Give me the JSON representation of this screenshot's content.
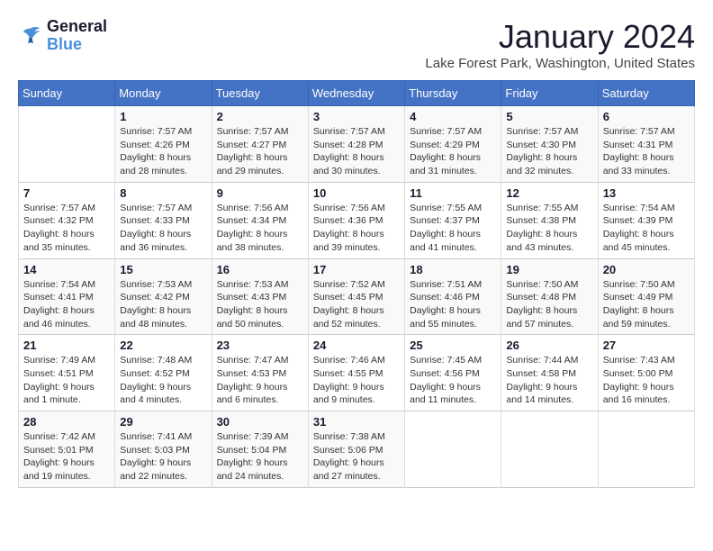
{
  "header": {
    "logo_text_general": "General",
    "logo_text_blue": "Blue",
    "month_title": "January 2024",
    "location": "Lake Forest Park, Washington, United States"
  },
  "weekdays": [
    "Sunday",
    "Monday",
    "Tuesday",
    "Wednesday",
    "Thursday",
    "Friday",
    "Saturday"
  ],
  "weeks": [
    [
      {
        "day": "",
        "sunrise": "",
        "sunset": "",
        "daylight": ""
      },
      {
        "day": "1",
        "sunrise": "Sunrise: 7:57 AM",
        "sunset": "Sunset: 4:26 PM",
        "daylight": "Daylight: 8 hours and 28 minutes."
      },
      {
        "day": "2",
        "sunrise": "Sunrise: 7:57 AM",
        "sunset": "Sunset: 4:27 PM",
        "daylight": "Daylight: 8 hours and 29 minutes."
      },
      {
        "day": "3",
        "sunrise": "Sunrise: 7:57 AM",
        "sunset": "Sunset: 4:28 PM",
        "daylight": "Daylight: 8 hours and 30 minutes."
      },
      {
        "day": "4",
        "sunrise": "Sunrise: 7:57 AM",
        "sunset": "Sunset: 4:29 PM",
        "daylight": "Daylight: 8 hours and 31 minutes."
      },
      {
        "day": "5",
        "sunrise": "Sunrise: 7:57 AM",
        "sunset": "Sunset: 4:30 PM",
        "daylight": "Daylight: 8 hours and 32 minutes."
      },
      {
        "day": "6",
        "sunrise": "Sunrise: 7:57 AM",
        "sunset": "Sunset: 4:31 PM",
        "daylight": "Daylight: 8 hours and 33 minutes."
      }
    ],
    [
      {
        "day": "7",
        "sunrise": "Sunrise: 7:57 AM",
        "sunset": "Sunset: 4:32 PM",
        "daylight": "Daylight: 8 hours and 35 minutes."
      },
      {
        "day": "8",
        "sunrise": "Sunrise: 7:57 AM",
        "sunset": "Sunset: 4:33 PM",
        "daylight": "Daylight: 8 hours and 36 minutes."
      },
      {
        "day": "9",
        "sunrise": "Sunrise: 7:56 AM",
        "sunset": "Sunset: 4:34 PM",
        "daylight": "Daylight: 8 hours and 38 minutes."
      },
      {
        "day": "10",
        "sunrise": "Sunrise: 7:56 AM",
        "sunset": "Sunset: 4:36 PM",
        "daylight": "Daylight: 8 hours and 39 minutes."
      },
      {
        "day": "11",
        "sunrise": "Sunrise: 7:55 AM",
        "sunset": "Sunset: 4:37 PM",
        "daylight": "Daylight: 8 hours and 41 minutes."
      },
      {
        "day": "12",
        "sunrise": "Sunrise: 7:55 AM",
        "sunset": "Sunset: 4:38 PM",
        "daylight": "Daylight: 8 hours and 43 minutes."
      },
      {
        "day": "13",
        "sunrise": "Sunrise: 7:54 AM",
        "sunset": "Sunset: 4:39 PM",
        "daylight": "Daylight: 8 hours and 45 minutes."
      }
    ],
    [
      {
        "day": "14",
        "sunrise": "Sunrise: 7:54 AM",
        "sunset": "Sunset: 4:41 PM",
        "daylight": "Daylight: 8 hours and 46 minutes."
      },
      {
        "day": "15",
        "sunrise": "Sunrise: 7:53 AM",
        "sunset": "Sunset: 4:42 PM",
        "daylight": "Daylight: 8 hours and 48 minutes."
      },
      {
        "day": "16",
        "sunrise": "Sunrise: 7:53 AM",
        "sunset": "Sunset: 4:43 PM",
        "daylight": "Daylight: 8 hours and 50 minutes."
      },
      {
        "day": "17",
        "sunrise": "Sunrise: 7:52 AM",
        "sunset": "Sunset: 4:45 PM",
        "daylight": "Daylight: 8 hours and 52 minutes."
      },
      {
        "day": "18",
        "sunrise": "Sunrise: 7:51 AM",
        "sunset": "Sunset: 4:46 PM",
        "daylight": "Daylight: 8 hours and 55 minutes."
      },
      {
        "day": "19",
        "sunrise": "Sunrise: 7:50 AM",
        "sunset": "Sunset: 4:48 PM",
        "daylight": "Daylight: 8 hours and 57 minutes."
      },
      {
        "day": "20",
        "sunrise": "Sunrise: 7:50 AM",
        "sunset": "Sunset: 4:49 PM",
        "daylight": "Daylight: 8 hours and 59 minutes."
      }
    ],
    [
      {
        "day": "21",
        "sunrise": "Sunrise: 7:49 AM",
        "sunset": "Sunset: 4:51 PM",
        "daylight": "Daylight: 9 hours and 1 minute."
      },
      {
        "day": "22",
        "sunrise": "Sunrise: 7:48 AM",
        "sunset": "Sunset: 4:52 PM",
        "daylight": "Daylight: 9 hours and 4 minutes."
      },
      {
        "day": "23",
        "sunrise": "Sunrise: 7:47 AM",
        "sunset": "Sunset: 4:53 PM",
        "daylight": "Daylight: 9 hours and 6 minutes."
      },
      {
        "day": "24",
        "sunrise": "Sunrise: 7:46 AM",
        "sunset": "Sunset: 4:55 PM",
        "daylight": "Daylight: 9 hours and 9 minutes."
      },
      {
        "day": "25",
        "sunrise": "Sunrise: 7:45 AM",
        "sunset": "Sunset: 4:56 PM",
        "daylight": "Daylight: 9 hours and 11 minutes."
      },
      {
        "day": "26",
        "sunrise": "Sunrise: 7:44 AM",
        "sunset": "Sunset: 4:58 PM",
        "daylight": "Daylight: 9 hours and 14 minutes."
      },
      {
        "day": "27",
        "sunrise": "Sunrise: 7:43 AM",
        "sunset": "Sunset: 5:00 PM",
        "daylight": "Daylight: 9 hours and 16 minutes."
      }
    ],
    [
      {
        "day": "28",
        "sunrise": "Sunrise: 7:42 AM",
        "sunset": "Sunset: 5:01 PM",
        "daylight": "Daylight: 9 hours and 19 minutes."
      },
      {
        "day": "29",
        "sunrise": "Sunrise: 7:41 AM",
        "sunset": "Sunset: 5:03 PM",
        "daylight": "Daylight: 9 hours and 22 minutes."
      },
      {
        "day": "30",
        "sunrise": "Sunrise: 7:39 AM",
        "sunset": "Sunset: 5:04 PM",
        "daylight": "Daylight: 9 hours and 24 minutes."
      },
      {
        "day": "31",
        "sunrise": "Sunrise: 7:38 AM",
        "sunset": "Sunset: 5:06 PM",
        "daylight": "Daylight: 9 hours and 27 minutes."
      },
      {
        "day": "",
        "sunrise": "",
        "sunset": "",
        "daylight": ""
      },
      {
        "day": "",
        "sunrise": "",
        "sunset": "",
        "daylight": ""
      },
      {
        "day": "",
        "sunrise": "",
        "sunset": "",
        "daylight": ""
      }
    ]
  ]
}
